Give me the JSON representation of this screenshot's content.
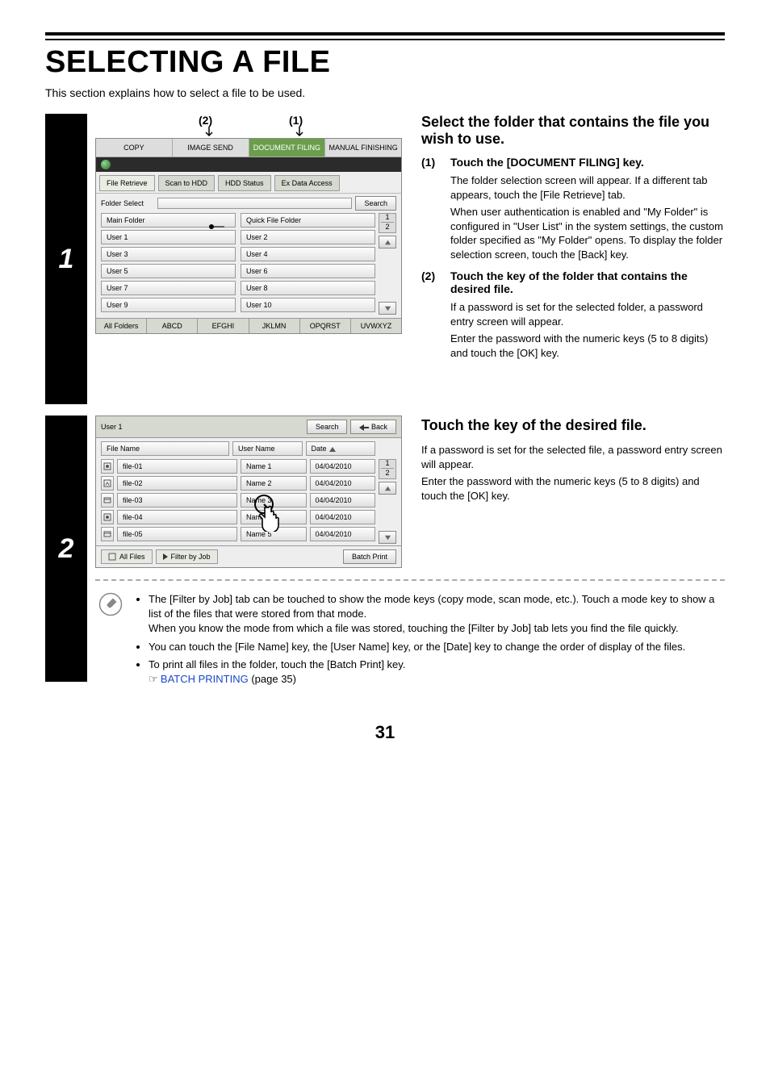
{
  "page": {
    "title": "SELECTING A FILE",
    "intro": "This section explains how to select a file to be used.",
    "number": "31"
  },
  "step1": {
    "num": "1",
    "callout1": "(1)",
    "callout2": "(2)",
    "heading": "Select the folder that contains the file you wish to use.",
    "sub1_num": "(1)",
    "sub1_title": "Touch the [DOCUMENT FILING] key.",
    "sub1_body_a": "The folder selection screen will appear. If a different tab appears, touch the [File Retrieve] tab.",
    "sub1_body_b": "When user authentication is enabled and \"My Folder\" is configured in \"User List\" in the system settings, the custom folder specified as \"My Folder\" opens. To display the folder selection screen, touch the [Back] key.",
    "sub2_num": "(2)",
    "sub2_title": "Touch the key of the folder that contains the desired file.",
    "sub2_body_a": "If a password is set for the selected folder, a password entry screen will appear.",
    "sub2_body_b": "Enter the password with the numeric keys (5 to 8 digits) and touch the [OK] key.",
    "panel": {
      "tabs": {
        "copy": "COPY",
        "image_send": "IMAGE SEND",
        "doc_filing": "DOCUMENT FILING",
        "manual_fin": "MANUAL FINISHING"
      },
      "subtabs": {
        "file_retrieve": "File Retrieve",
        "scan_hdd": "Scan to HDD",
        "hdd_status": "HDD Status",
        "ex_data": "Ex Data Access"
      },
      "folder_select": "Folder Select",
      "search": "Search",
      "main_folder": "Main Folder",
      "quick_file": "Quick File Folder",
      "users": [
        "User 1",
        "User 2",
        "User 3",
        "User 4",
        "User 5",
        "User 6",
        "User 7",
        "User 8",
        "User 9",
        "User 10"
      ],
      "page_a": "1",
      "page_b": "2",
      "footer": [
        "All Folders",
        "ABCD",
        "EFGHI",
        "JKLMN",
        "OPQRST",
        "UVWXYZ"
      ]
    }
  },
  "step2": {
    "num": "2",
    "heading": "Touch the key of the desired file.",
    "body_a": "If a password is set for the selected file, a password entry screen will appear.",
    "body_b": "Enter the password with the numeric keys (5 to 8 digits) and touch the [OK] key.",
    "panel": {
      "folder": "User 1",
      "search": "Search",
      "back": "Back",
      "col_file": "File Name",
      "col_user": "User Name",
      "col_date": "Date",
      "page_a": "1",
      "page_b": "2",
      "rows": [
        {
          "file": "file-01",
          "user": "Name 1",
          "date": "04/04/2010"
        },
        {
          "file": "file-02",
          "user": "Name 2",
          "date": "04/04/2010"
        },
        {
          "file": "file-03",
          "user": "Name 3",
          "date": "04/04/2010"
        },
        {
          "file": "file-04",
          "user": "Name 4",
          "date": "04/04/2010"
        },
        {
          "file": "file-05",
          "user": "Name 5",
          "date": "04/04/2010"
        }
      ],
      "all_files": "All Files",
      "filter": "Filter by Job",
      "batch": "Batch Print"
    },
    "notes": {
      "n1": "The [Filter by Job] tab can be touched to show the mode keys (copy mode, scan mode, etc.). Touch a mode key to show a list of the files that were stored from that mode.",
      "n1b": "When you know the mode from which a file was stored, touching the [Filter by Job] tab lets you find the file quickly.",
      "n2": "You can touch the [File Name] key, the [User Name] key, or the [Date] key to change the order of display of the files.",
      "n3": "To print all files in the folder, touch the [Batch Print] key.",
      "link_text": "BATCH PRINTING",
      "link_page": " (page 35)"
    }
  }
}
